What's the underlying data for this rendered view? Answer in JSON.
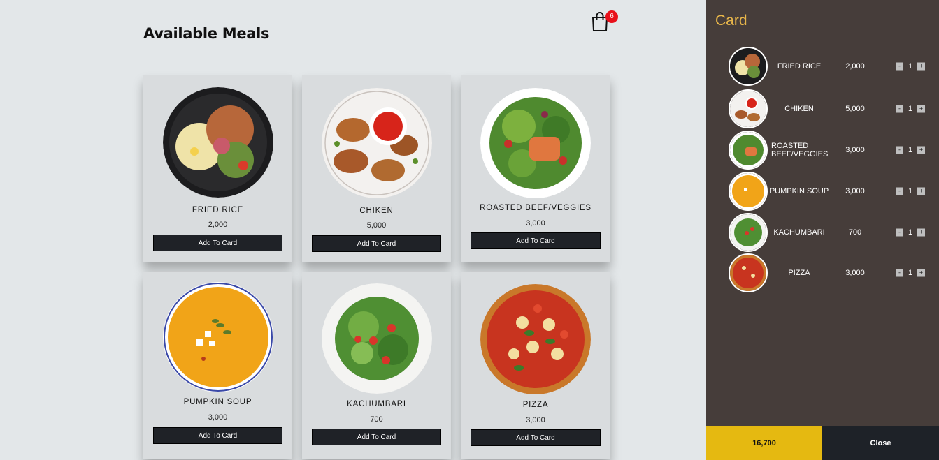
{
  "main": {
    "title": "Available Meals",
    "cart_count": "6",
    "meals": [
      {
        "name": "FRIED RICE",
        "price": "2,000",
        "button": "Add To Card"
      },
      {
        "name": "CHIKEN",
        "price": "5,000",
        "button": "Add To Card"
      },
      {
        "name": "ROASTED BEEF/VEGGIES",
        "price": "3,000",
        "button": "Add To Card"
      },
      {
        "name": "PUMPKIN SOUP",
        "price": "3,000",
        "button": "Add To Card"
      },
      {
        "name": "KACHUMBARI",
        "price": "700",
        "button": "Add To Card"
      },
      {
        "name": "PIZZA",
        "price": "3,000",
        "button": "Add To Card"
      }
    ]
  },
  "sidebar": {
    "title": "Card",
    "minus_label": "-",
    "plus_label": "+",
    "items": [
      {
        "name": "FRIED RICE",
        "price": "2,000",
        "qty": "1"
      },
      {
        "name": "CHIKEN",
        "price": "5,000",
        "qty": "1"
      },
      {
        "name": "ROASTED BEEF/VEGGIES",
        "price": "3,000",
        "qty": "1"
      },
      {
        "name": "PUMPKIN SOUP",
        "price": "3,000",
        "qty": "1"
      },
      {
        "name": "KACHUMBARI",
        "price": "700",
        "qty": "1"
      },
      {
        "name": "PIZZA",
        "price": "3,000",
        "qty": "1"
      }
    ],
    "total": "16,700",
    "close_label": "Close"
  },
  "colors": {
    "accent": "#e8b64a",
    "total_bg": "#e5b911",
    "sidebar_bg": "#463d3a",
    "button_bg": "#1f2227",
    "badge": "#e8101a"
  }
}
